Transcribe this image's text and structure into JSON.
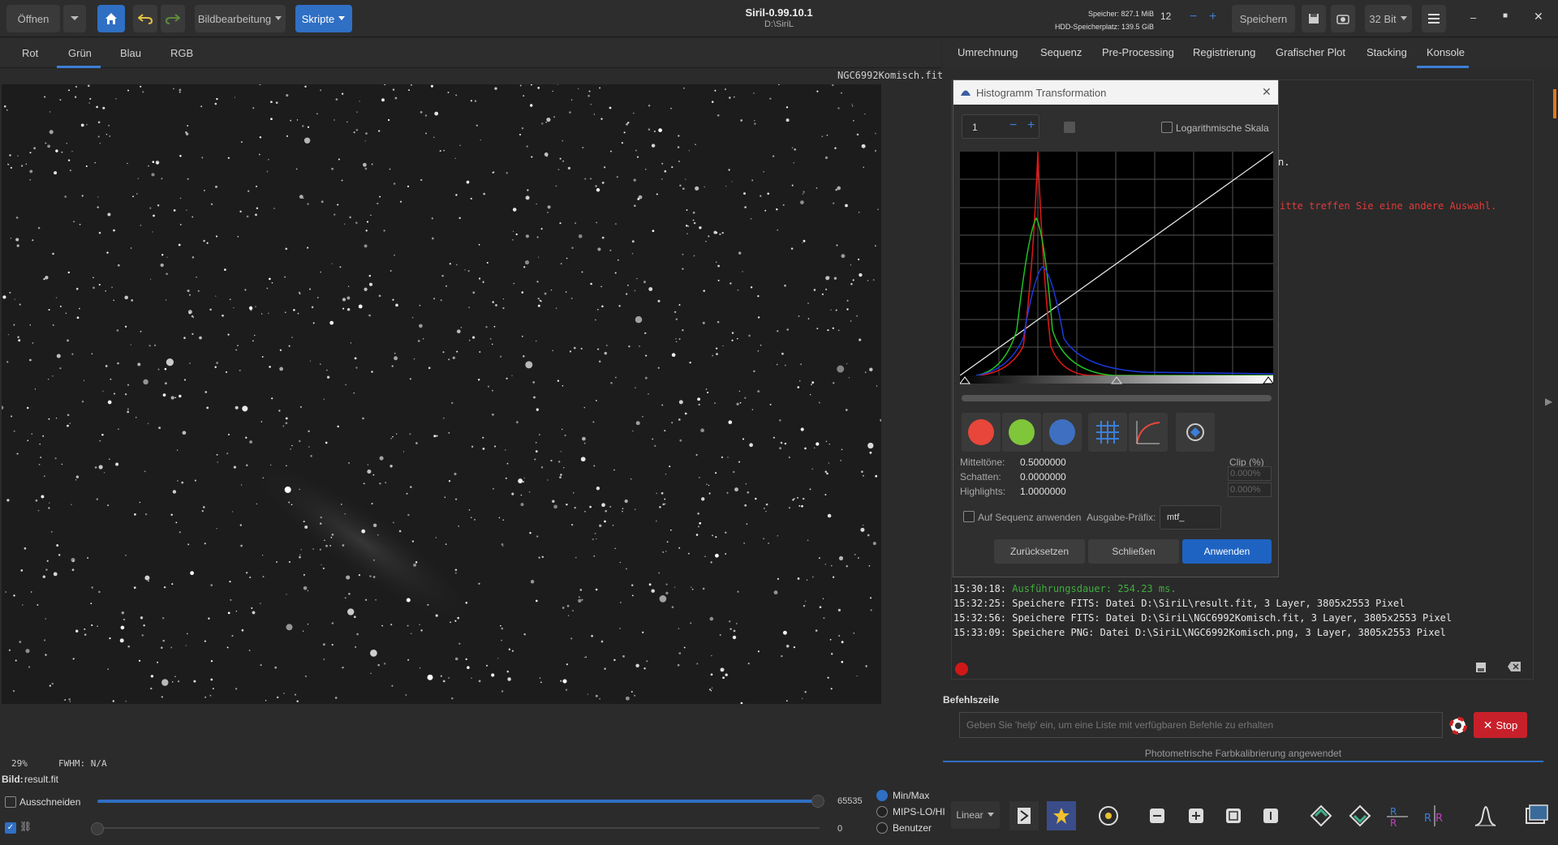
{
  "header": {
    "open_label": "Öffnen",
    "image_processing_label": "Bildbearbeitung",
    "scripts_label": "Skripte",
    "app_title": "Siril-0.99.10.1",
    "working_dir": "D:\\SiriL",
    "memory_label": "Speicher: 827.1 MiB",
    "disk_label": "HDD-Speicherplatz: 139.5 GiB",
    "threads_value": "12",
    "save_label": "Speichern",
    "bitdepth_label": "32 Bit"
  },
  "left_tabs": [
    "Rot",
    "Grün",
    "Blau",
    "RGB"
  ],
  "image": {
    "filename": "NGC6992Komisch.fit",
    "zoom": "29%",
    "fwhm": "FWHM: N/A"
  },
  "right_tabs": [
    "Umrechnung",
    "Sequenz",
    "Pre-Processing",
    "Registrierung",
    "Grafischer Plot",
    "Stacking",
    "Konsole"
  ],
  "console": {
    "partial_line_1": "n.",
    "partial_error": "itte treffen Sie eine andere Auswahl.",
    "logs": [
      {
        "time": "15:30:18:",
        "text": "Ausführungsdauer: 254.23 ms.",
        "color": "#3fae3f"
      },
      {
        "time": "15:32:25:",
        "text": "Speichere FITS: Datei D:\\SiriL\\result.fit, 3 Layer, 3805x2553 Pixel",
        "color": "#e6e6e6"
      },
      {
        "time": "15:32:56:",
        "text": "Speichere FITS: Datei D:\\SiriL\\NGC6992Komisch.fit, 3 Layer, 3805x2553 Pixel",
        "color": "#e6e6e6"
      },
      {
        "time": "15:33:09:",
        "text": "Speichere PNG: Datei D:\\SiriL\\NGC6992Komisch.png, 3 Layer, 3805x2553 Pixel",
        "color": "#e6e6e6"
      }
    ],
    "command_heading": "Befehlszeile",
    "command_placeholder": "Geben Sie 'help' ein, um eine Liste mit verfügbaren Befehle zu erhalten",
    "stop_label": "Stop",
    "status": "Photometrische Farbkalibrierung angewendet"
  },
  "dialog": {
    "title": "Histogramm Transformation",
    "zoom_value": "1",
    "log_scale_label": "Logarithmische Skala",
    "midtones_label": "Mitteltöne:",
    "midtones_value": "0.5000000",
    "shadows_label": "Schatten:",
    "shadows_value": "0.0000000",
    "highlights_label": "Highlights:",
    "highlights_value": "1.0000000",
    "clip_label": "Clip (%)",
    "clip_shadows": "0.000%",
    "clip_highlights": "0.000%",
    "apply_seq_label": "Auf Sequenz anwenden",
    "prefix_label": "Ausgabe-Präfix:",
    "prefix_value": "mtf_",
    "reset_label": "Zurücksetzen",
    "close_label": "Schließen",
    "apply_label": "Anwenden"
  },
  "bottom": {
    "image_label": "Bild:",
    "image_file": "result.fit",
    "crop_label": "Ausschneiden",
    "max_value": "65535",
    "min_value": "0",
    "radio_minmax": "Min/Max",
    "radio_mips": "MIPS-LO/HI",
    "radio_user": "Benutzer",
    "stretch_mode": "Linear"
  },
  "colors": {
    "accent": "#2f6fc4",
    "stop_red": "#c8202a",
    "red_channel": "#e8463a",
    "green_channel": "#7fc63a",
    "blue_channel": "#3f6fc0"
  }
}
